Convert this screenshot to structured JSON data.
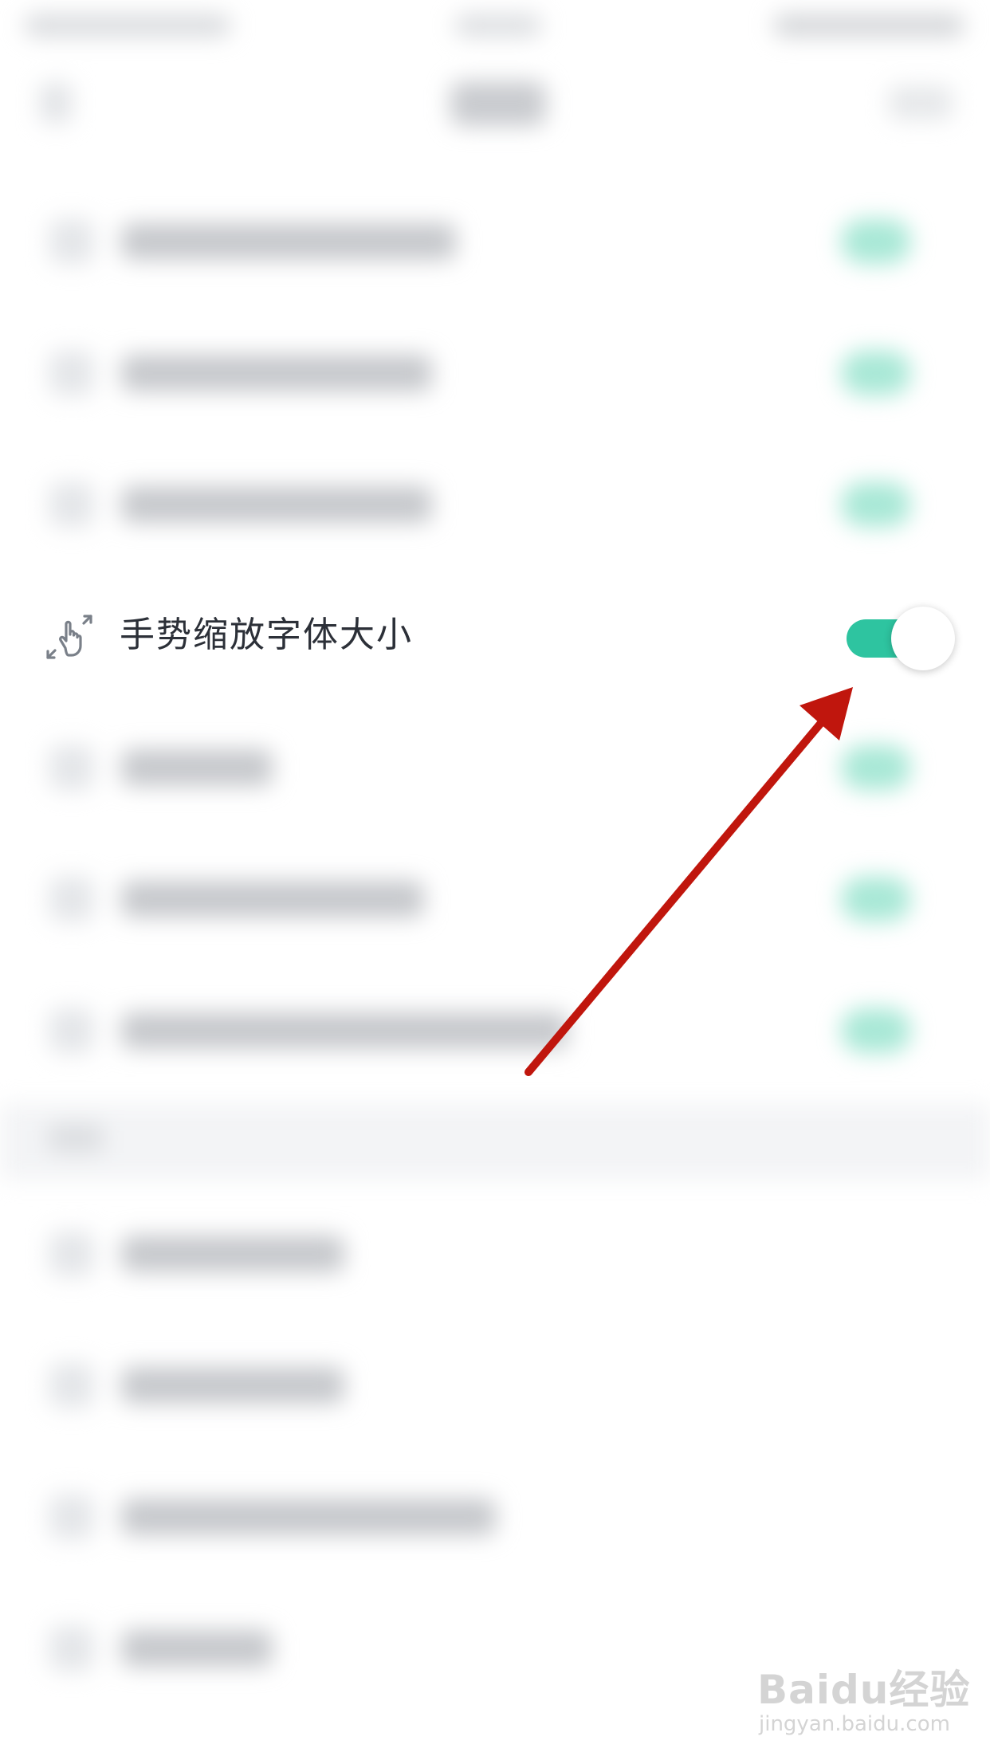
{
  "settings_row": {
    "label": "手势缩放字体大小",
    "icon": "pinch-zoom-gesture-icon",
    "toggle_on": true
  },
  "colors": {
    "toggle_on": "#2ec4a0",
    "toggle_blurred": "#a8e8d6",
    "annotation_arrow": "#c0160d",
    "label_text": "#2c3038"
  },
  "watermark": {
    "brand": "Baidu经验",
    "url": "jingyan.baidu.com"
  }
}
